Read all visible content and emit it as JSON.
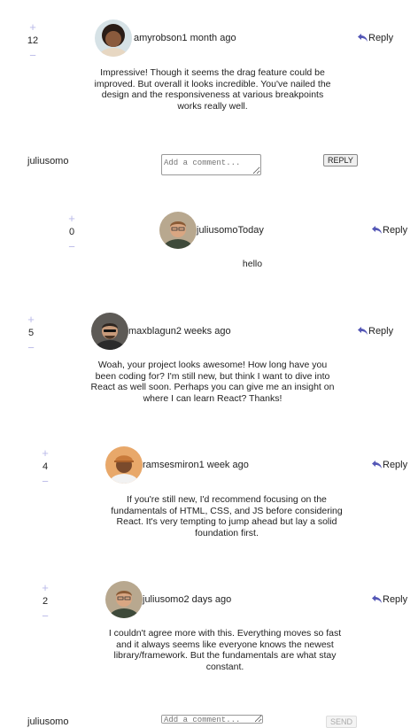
{
  "comments": [
    {
      "score": "12",
      "username": "amyrobson",
      "time": "1 month ago",
      "reply": "Reply",
      "body": "Impressive! Though it seems the drag feature could be improved. But overall it looks incredible. You've nailed the design and the responsiveness at various breakpoints works really well."
    },
    {
      "score": "0",
      "username": "juliusomo",
      "time": "Today",
      "reply": "Reply",
      "body": "hello"
    },
    {
      "score": "5",
      "username": "maxblagun",
      "time": "2 weeks ago",
      "reply": "Reply",
      "body": "Woah, your project looks awesome! How long have you been coding for? I'm still new, but think I want to dive into React as well soon. Perhaps you can give me an insight on where I can learn React? Thanks!"
    },
    {
      "score": "4",
      "username": "ramsesmiron",
      "time": "1 week ago",
      "reply": "Reply",
      "body": "If you're still new, I'd recommend focusing on the fundamentals of HTML, CSS, and JS before considering React. It's very tempting to jump ahead but lay a solid foundation first."
    },
    {
      "score": "2",
      "username": "juliusomo",
      "time": "2 days ago",
      "reply": "Reply",
      "body": "I couldn't agree more with this. Everything moves so fast and it always seems like everyone knows the newest library/framework. But the fundamentals are what stay constant."
    }
  ],
  "vote": {
    "plus": "+",
    "minus": "−"
  },
  "reply_form": {
    "username": "juliusomo",
    "placeholder": "Add a comment...",
    "button": "REPLY"
  },
  "new_comment_form": {
    "username": "juliusomo",
    "placeholder": "Add a comment...",
    "button": "SEND"
  },
  "colors": {
    "vote": "#b9b9e8",
    "reply_icon": "#5457b6"
  }
}
